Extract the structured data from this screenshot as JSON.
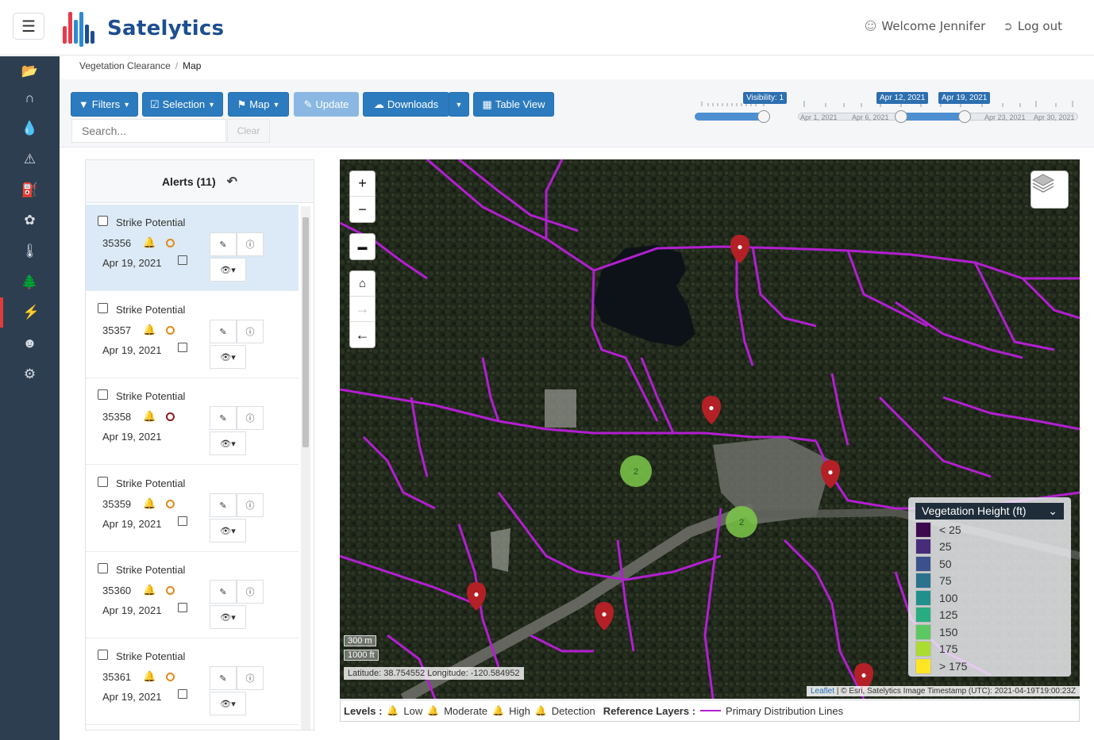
{
  "app": {
    "brand": "Satelytics",
    "welcome": "Welcome Jennifer",
    "logout": "Log out"
  },
  "breadcrumb": {
    "parent": "Vegetation Clearance",
    "current": "Map"
  },
  "toolbar": {
    "filters": "Filters",
    "selection": "Selection",
    "map": "Map",
    "update": "Update",
    "downloads": "Downloads",
    "table_view": "Table View",
    "search_placeholder": "Search...",
    "clear": "Clear"
  },
  "visibility_slider": {
    "label": "Visibility: 1",
    "level": 1
  },
  "date_slider": {
    "start_label": "Apr 12, 2021",
    "end_label": "Apr 19, 2021",
    "ticks": [
      "Apr 1, 2021",
      "Apr 6, 2021",
      "Apr 23, 2021",
      "Apr 30, 2021"
    ]
  },
  "alerts": {
    "title": "Alerts (11)",
    "items": [
      {
        "type": "Strike Potential",
        "id": "35356",
        "date": "Apr 19, 2021",
        "status": "orange"
      },
      {
        "type": "Strike Potential",
        "id": "35357",
        "date": "Apr 19, 2021",
        "status": "orange"
      },
      {
        "type": "Strike Potential",
        "id": "35358",
        "date": "Apr 19, 2021",
        "status": "dark"
      },
      {
        "type": "Strike Potential",
        "id": "35359",
        "date": "Apr 19, 2021",
        "status": "orange"
      },
      {
        "type": "Strike Potential",
        "id": "35360",
        "date": "Apr 19, 2021",
        "status": "orange"
      },
      {
        "type": "Strike Potential",
        "id": "35361",
        "date": "Apr 19, 2021",
        "status": "orange"
      }
    ]
  },
  "map": {
    "clusters": [
      "2",
      "2"
    ],
    "scale_m": "300 m",
    "scale_ft": "1000 ft",
    "coords": "Latitude: 38.754552 Longitude: -120.584952",
    "attribution_leaflet": "Leaflet",
    "attribution_rest": "| © Esri, Satelytics Image Timestamp (UTC): 2021-04-19T19:00:23Z",
    "legend": {
      "title": "Vegetation Height (ft)",
      "rows": [
        {
          "label": "< 25",
          "color": "#3d0a4f"
        },
        {
          "label": "25",
          "color": "#472c7a"
        },
        {
          "label": "50",
          "color": "#3b518b"
        },
        {
          "label": "75",
          "color": "#2c718e"
        },
        {
          "label": "100",
          "color": "#21908d"
        },
        {
          "label": "125",
          "color": "#27ad81"
        },
        {
          "label": "150",
          "color": "#5cc863"
        },
        {
          "label": "175",
          "color": "#aadc32"
        },
        {
          "label": "> 175",
          "color": "#fde725"
        }
      ]
    }
  },
  "levels_bar": {
    "levels_label": "Levels :",
    "low": "Low",
    "moderate": "Moderate",
    "high": "High",
    "detection": "Detection",
    "ref_label": "Reference Layers :",
    "ref_item": "Primary Distribution Lines"
  },
  "colors": {
    "primary": "#2c7bbf",
    "sidebar": "#2d3e50",
    "line": "#b21fd0",
    "alert": "#b32026"
  }
}
